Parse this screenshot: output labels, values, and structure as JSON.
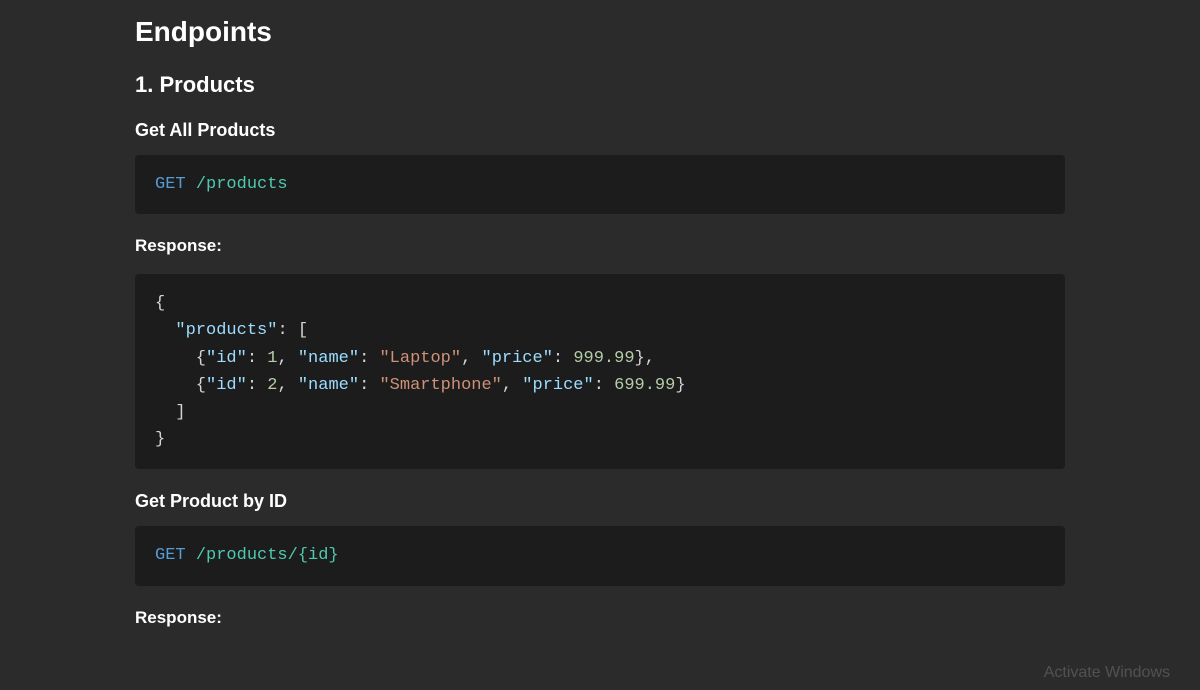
{
  "section": {
    "title": "Endpoints"
  },
  "subsection": {
    "title": "1. Products"
  },
  "blocks": {
    "getAll": {
      "title": "Get All Products",
      "request": {
        "method": "GET",
        "path": "/products"
      },
      "responseLabel": "Response:",
      "responseLines": [
        [
          {
            "cls": "tk-punc",
            "t": "{"
          }
        ],
        [
          {
            "cls": "tk-punc",
            "t": "  "
          },
          {
            "cls": "tk-key",
            "t": "\"products\""
          },
          {
            "cls": "tk-punc",
            "t": ": ["
          }
        ],
        [
          {
            "cls": "tk-punc",
            "t": "    {"
          },
          {
            "cls": "tk-key",
            "t": "\"id\""
          },
          {
            "cls": "tk-punc",
            "t": ": "
          },
          {
            "cls": "tk-number",
            "t": "1"
          },
          {
            "cls": "tk-punc",
            "t": ", "
          },
          {
            "cls": "tk-key",
            "t": "\"name\""
          },
          {
            "cls": "tk-punc",
            "t": ": "
          },
          {
            "cls": "tk-string",
            "t": "\"Laptop\""
          },
          {
            "cls": "tk-punc",
            "t": ", "
          },
          {
            "cls": "tk-key",
            "t": "\"price\""
          },
          {
            "cls": "tk-punc",
            "t": ": "
          },
          {
            "cls": "tk-number",
            "t": "999.99"
          },
          {
            "cls": "tk-punc",
            "t": "},"
          }
        ],
        [
          {
            "cls": "tk-punc",
            "t": "    {"
          },
          {
            "cls": "tk-key",
            "t": "\"id\""
          },
          {
            "cls": "tk-punc",
            "t": ": "
          },
          {
            "cls": "tk-number",
            "t": "2"
          },
          {
            "cls": "tk-punc",
            "t": ", "
          },
          {
            "cls": "tk-key",
            "t": "\"name\""
          },
          {
            "cls": "tk-punc",
            "t": ": "
          },
          {
            "cls": "tk-string",
            "t": "\"Smartphone\""
          },
          {
            "cls": "tk-punc",
            "t": ", "
          },
          {
            "cls": "tk-key",
            "t": "\"price\""
          },
          {
            "cls": "tk-punc",
            "t": ": "
          },
          {
            "cls": "tk-number",
            "t": "699.99"
          },
          {
            "cls": "tk-punc",
            "t": "}"
          }
        ],
        [
          {
            "cls": "tk-punc",
            "t": "  ]"
          }
        ],
        [
          {
            "cls": "tk-punc",
            "t": "}"
          }
        ]
      ]
    },
    "getById": {
      "title": "Get Product by ID",
      "request": {
        "method": "GET",
        "path": "/products/{id}"
      },
      "responseLabel": "Response:"
    }
  },
  "watermark": "Activate Windows"
}
